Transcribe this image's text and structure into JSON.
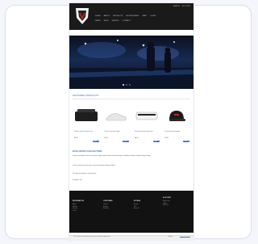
{
  "header": {
    "nav_row1": [
      "HOME",
      "ABOUT",
      "PRODUCTS",
      "ACCESSORIES",
      "CART",
      "LOGIN"
    ],
    "nav_row2": [
      "NEWS",
      "SHOP",
      "EVENTS",
      "CONTACT"
    ],
    "util": [
      "SEARCH",
      "ACCOUNT"
    ]
  },
  "hero": {
    "caption": ""
  },
  "featured": {
    "title": "FEATURED PRODUCTS",
    "products": [
      {
        "name": "Product item description text",
        "price": "$0.00",
        "add": "BUY"
      },
      {
        "name": "Product item description",
        "price": "$0.00",
        "add": "BUY"
      },
      {
        "name": "Product item description text",
        "price": "$0.00",
        "add": "BUY"
      },
      {
        "name": "Product item description",
        "price": "$0.00",
        "add": "BUY"
      }
    ]
  },
  "promo": {
    "title": "EXCLUSIVE COLLECTION",
    "para1": "Lorem ipsum dolor sit amet consectetur adipiscing elit sed do eiusmod tempor incididunt ut labore et dolore magna aliqua.",
    "para2": "Ut enim ad minim veniam quis nostrud exercitation ullamco laboris.",
    "para3": "Duis aute irure dolor in reprehenderit.",
    "para4": "Excepteur sint."
  },
  "footer": {
    "cols": [
      {
        "title": "INFORMATION",
        "links": [
          "About",
          "Delivery",
          "Privacy",
          "Terms"
        ]
      },
      {
        "title": "CUSTOMER",
        "links": [
          "Contact",
          "Returns",
          "Site Map"
        ]
      },
      {
        "title": "EXTRAS",
        "links": [
          "Brands",
          "Gift",
          "Specials"
        ]
      },
      {
        "title": "ACCOUNT",
        "links": [
          "My Account",
          "Orders",
          "Wish List"
        ]
      }
    ]
  },
  "cookie": {
    "text": "This website uses cookies to ensure you get the best experience.",
    "decline": "Decline",
    "accept": "Accept"
  },
  "colors": {
    "header": "#1a1a1a",
    "accent": "#2f6fd6",
    "link": "#1f5fbf",
    "footer": "#121212"
  }
}
